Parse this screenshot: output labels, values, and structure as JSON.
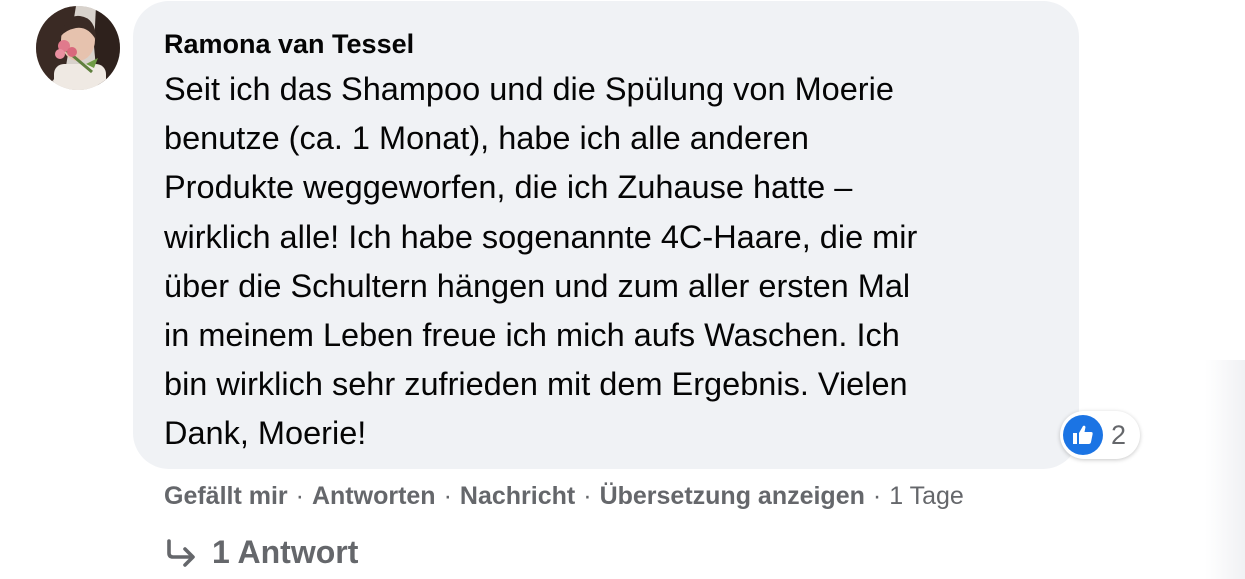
{
  "comment": {
    "author": "Ramona van Tessel",
    "text": "Seit ich das Shampoo und die Spülung von Moerie benutze (ca. 1 Monat), habe ich alle anderen Produkte weggeworfen, die ich Zuhause hatte – wirklich alle! Ich habe sogenannte 4C-Haare, die mir über die Schultern hängen und zum aller ersten Mal in meinem Leben freue ich mich aufs Waschen. Ich bin wirklich sehr zufrieden mit dem Ergebnis. Vielen Dank, Moerie!",
    "text_lines": [
      "Seit ich das Shampoo und die Spülung von Moerie",
      "benutze (ca. 1 Monat), habe ich alle anderen",
      "Produkte weggeworfen, die ich Zuhause hatte –",
      "wirklich alle! Ich habe sogenannte 4C-Haare, die mir",
      "über die Schultern hängen und zum aller ersten Mal",
      "in meinem Leben freue ich mich aufs Waschen. Ich",
      "bin wirklich sehr zufrieden mit dem Ergebnis. Vielen",
      "Dank, Moerie!"
    ],
    "reactions": {
      "icon": "like-icon",
      "count": "2"
    },
    "actions": {
      "like": "Gefällt mir",
      "reply": "Antworten",
      "message": "Nachricht",
      "translate": "Übersetzung anzeigen",
      "separator": "·",
      "timestamp": "1 Tage"
    },
    "replies": {
      "icon": "reply-arrow-icon",
      "label": "1 Antwort"
    }
  },
  "colors": {
    "bubble_bg": "#f0f2f5",
    "secondary_text": "#65676b",
    "like_blue": "#1b74e4",
    "primary_text": "#050505"
  }
}
